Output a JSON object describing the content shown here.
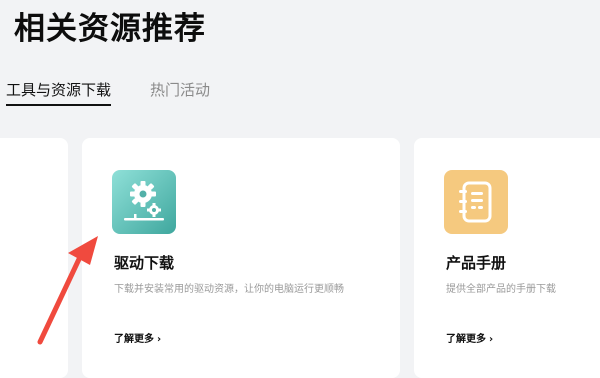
{
  "page": {
    "title": "相关资源推荐"
  },
  "tabs": [
    {
      "label": "工具与资源下载",
      "active": true
    },
    {
      "label": "热门活动",
      "active": false
    }
  ],
  "cards": [
    {
      "title": "驱动下载",
      "description": "下载并安装常用的驱动资源，让你的电脑运行更顺畅",
      "link_label": "了解更多",
      "link_chevron": "›",
      "icon": "gears-icon",
      "icon_color": "#4fb3aa"
    },
    {
      "title": "产品手册",
      "description": "提供全部产品的手册下载",
      "link_label": "了解更多",
      "link_chevron": "›",
      "icon": "notebook-icon",
      "icon_color": "#f5c97f"
    }
  ],
  "colors": {
    "background": "#f2f3f5",
    "card": "#ffffff",
    "annotation_arrow": "#f04a3e"
  }
}
